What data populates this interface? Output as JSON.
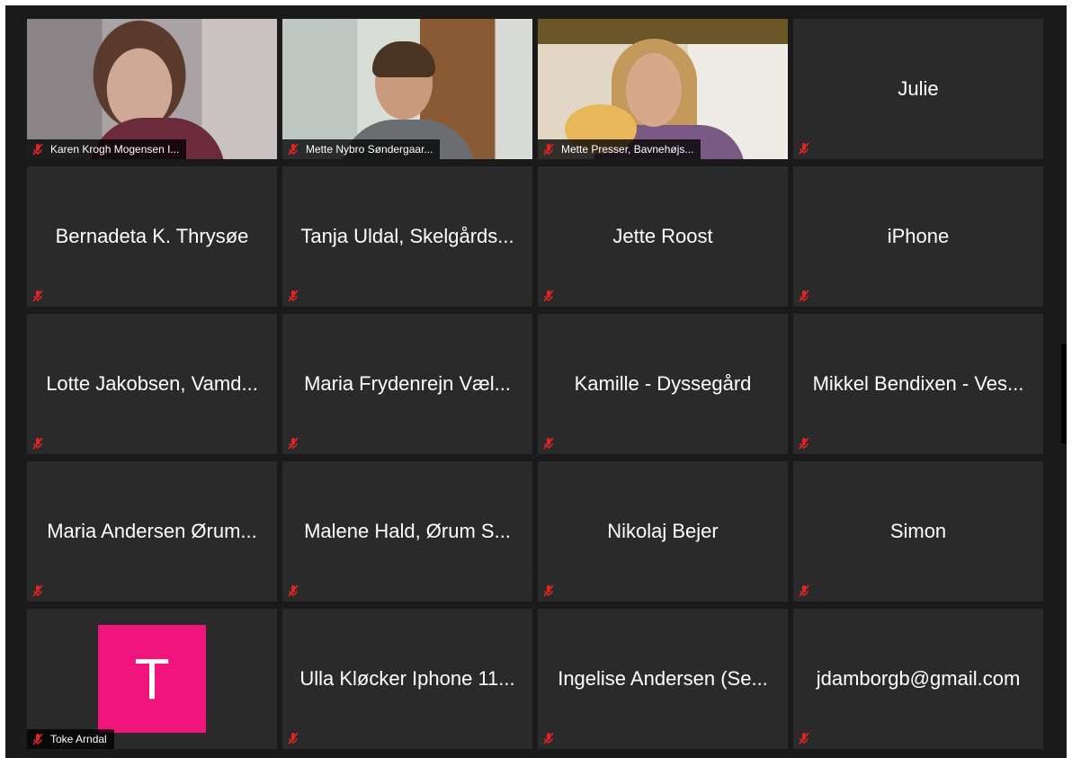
{
  "meeting": {
    "view": "gallery",
    "accent_muted_color": "#e02424",
    "participants": [
      {
        "name": "Karen Krogh Mogensen I...",
        "video": true,
        "muted": true
      },
      {
        "name": "Mette Nybro Søndergaar...",
        "video": true,
        "muted": true
      },
      {
        "name": "Mette Presser, Bavnehøjs...",
        "video": true,
        "muted": true
      },
      {
        "name": "Julie",
        "video": false,
        "muted": true
      },
      {
        "name": "Bernadeta K. Thrysøe",
        "video": false,
        "muted": true
      },
      {
        "name": "Tanja Uldal, Skelgårds...",
        "video": false,
        "muted": true
      },
      {
        "name": "Jette Roost",
        "video": false,
        "muted": true
      },
      {
        "name": "iPhone",
        "video": false,
        "muted": true
      },
      {
        "name": "Lotte Jakobsen, Vamd...",
        "video": false,
        "muted": true
      },
      {
        "name": "Maria Frydenrejn Væl...",
        "video": false,
        "muted": true
      },
      {
        "name": "Kamille - Dyssegård",
        "video": false,
        "muted": true
      },
      {
        "name": "Mikkel Bendixen - Ves...",
        "video": false,
        "muted": true
      },
      {
        "name": "Maria Andersen Ørum...",
        "video": false,
        "muted": true
      },
      {
        "name": "Malene Hald, Ørum S...",
        "video": false,
        "muted": true
      },
      {
        "name": "Nikolaj Bejer",
        "video": false,
        "muted": true
      },
      {
        "name": "Simon",
        "video": false,
        "muted": true
      },
      {
        "name": "Toke Arndal",
        "video": false,
        "muted": true,
        "avatar_letter": "T",
        "avatar_color": "#f0157c"
      },
      {
        "name": "Ulla Kløcker Iphone 11...",
        "video": false,
        "muted": true
      },
      {
        "name": "Ingelise Andersen (Se...",
        "video": false,
        "muted": true
      },
      {
        "name": "jdamborgb@gmail.com",
        "video": false,
        "muted": true
      }
    ]
  }
}
